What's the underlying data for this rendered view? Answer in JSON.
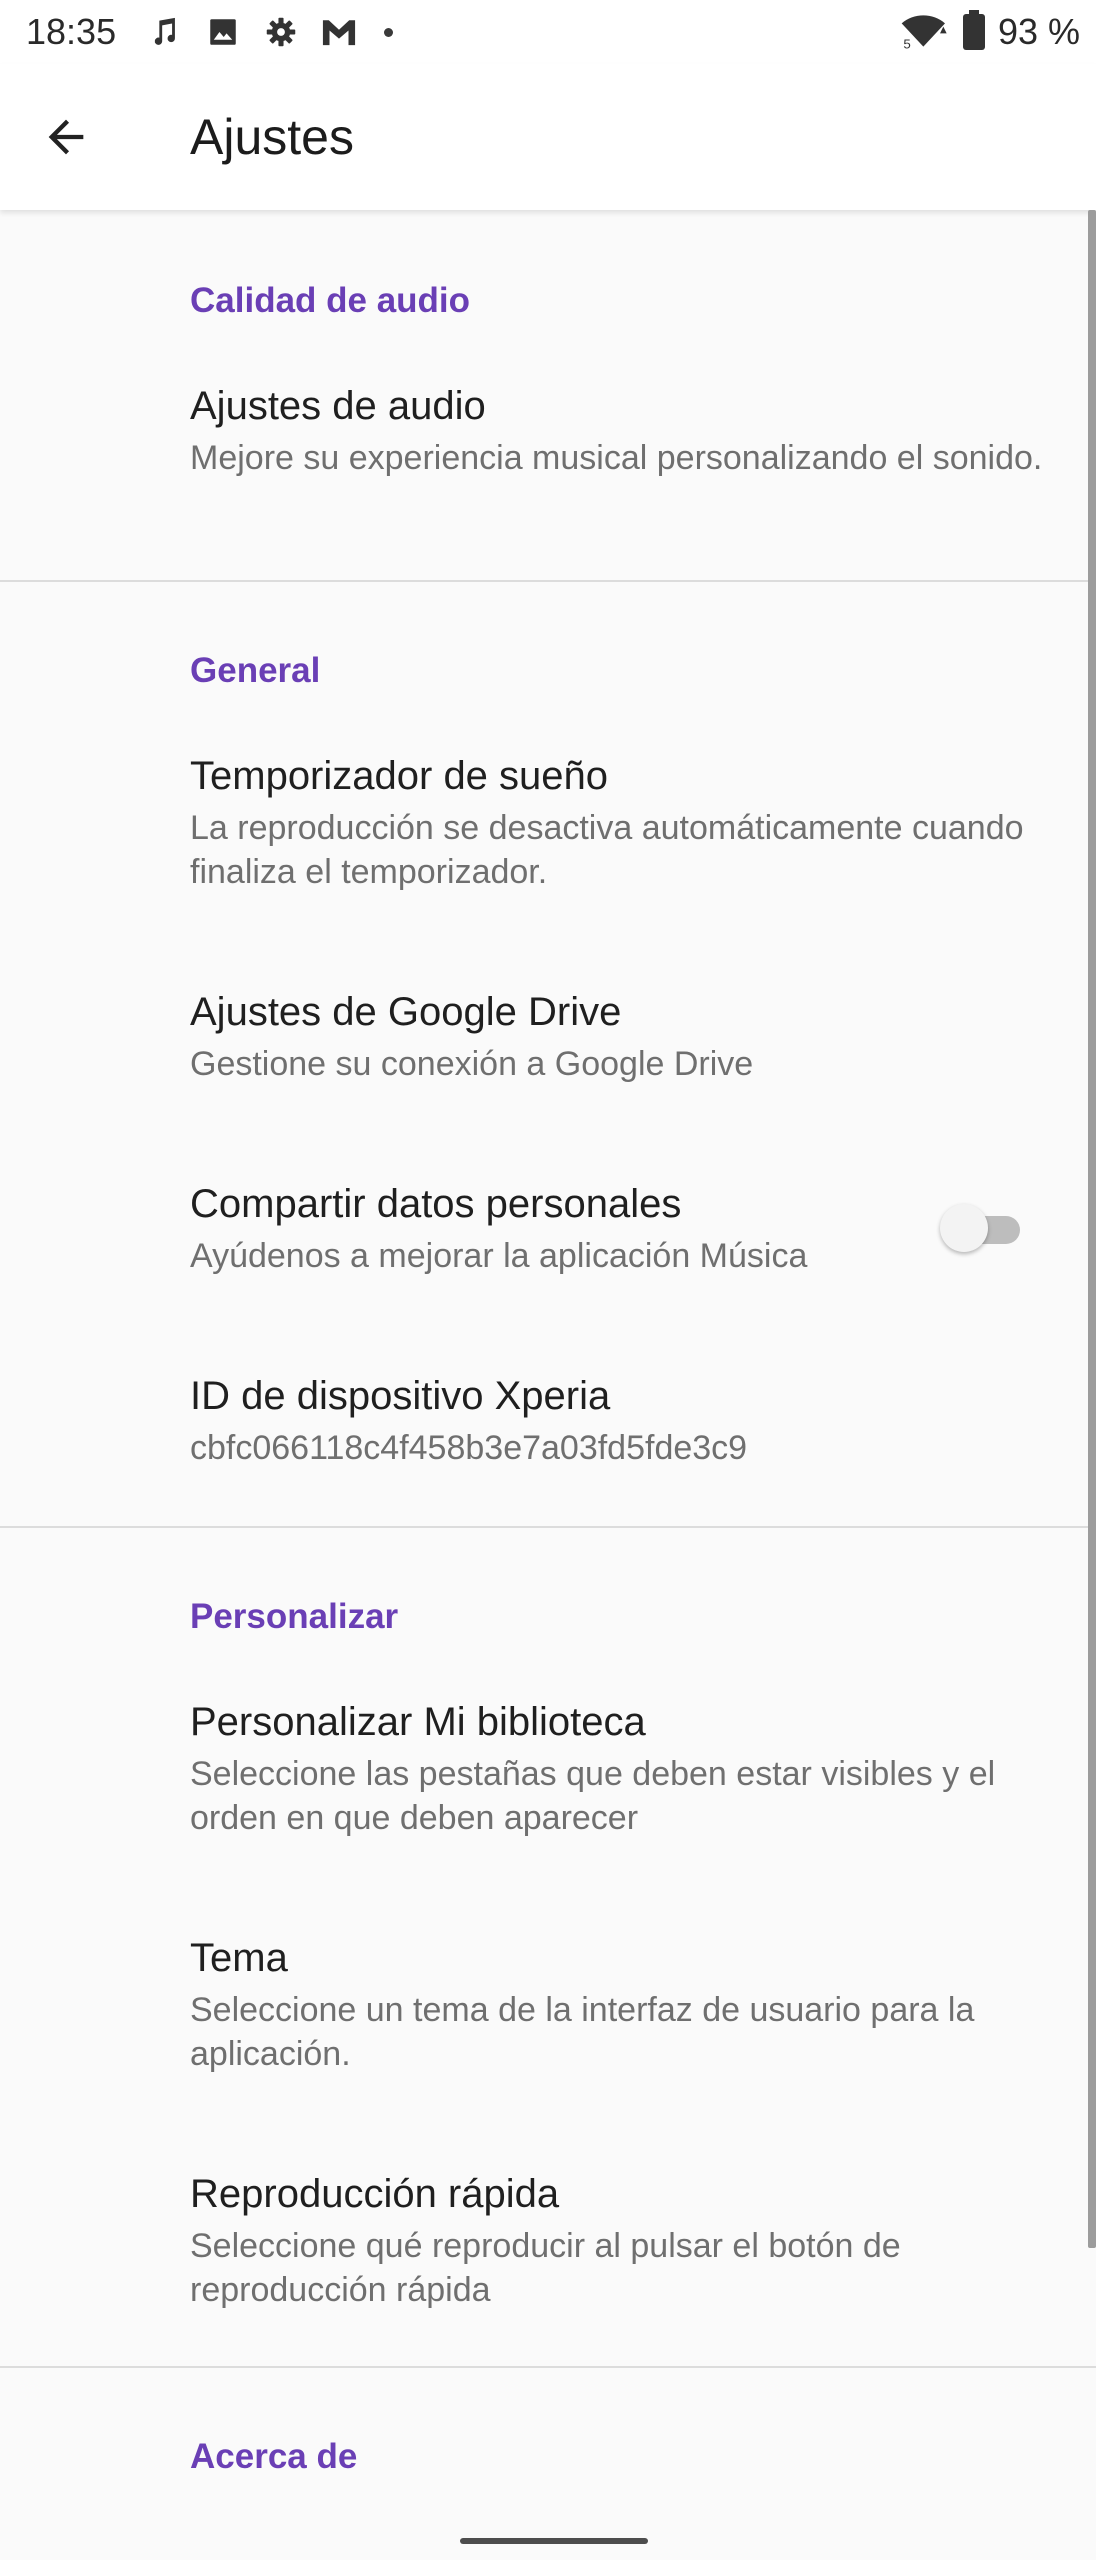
{
  "status_bar": {
    "time": "18:35",
    "battery_text": "93 %",
    "icons_left": [
      "music-note-icon",
      "image-icon",
      "settings-gear-icon",
      "gmail-icon",
      "dot-icon"
    ],
    "icons_right": [
      "wifi-icon",
      "battery-icon"
    ]
  },
  "app_bar": {
    "title": "Ajustes",
    "back_icon": "arrow-back-icon"
  },
  "colors": {
    "accent": "#6a3fb5",
    "title_text": "#1f1f1f",
    "summary_text": "#6f6f6f",
    "divider": "#dcdcdc",
    "background": "#fafafa"
  },
  "sections": [
    {
      "header": "Calidad de audio",
      "items": [
        {
          "title": "Ajustes de audio",
          "summary": "Mejore su experiencia musical personalizando el sonido."
        }
      ]
    },
    {
      "header": "General",
      "items": [
        {
          "title": "Temporizador de sueño",
          "summary": "La reproducción se desactiva automáticamente cuando finaliza el temporizador."
        },
        {
          "title": "Ajustes de Google Drive",
          "summary": "Gestione su conexión a Google Drive"
        },
        {
          "title": "Compartir datos personales",
          "summary": "Ayúdenos a mejorar la aplicación Música",
          "switch_on": false
        },
        {
          "title": "ID de dispositivo Xperia",
          "summary": "cbfc066118c4f458b3e7a03fd5fde3c9"
        }
      ]
    },
    {
      "header": "Personalizar",
      "items": [
        {
          "title": "Personalizar Mi biblioteca",
          "summary": "Seleccione las pestañas que deben estar visibles y el orden en que deben aparecer"
        },
        {
          "title": "Tema",
          "summary": "Seleccione un tema de la interfaz de usuario para la aplicación."
        },
        {
          "title": "Reproducción rápida",
          "summary": "Seleccione qué reproducir al pulsar el botón de reproducción rápida"
        }
      ]
    },
    {
      "header": "Acerca de",
      "items": []
    }
  ]
}
